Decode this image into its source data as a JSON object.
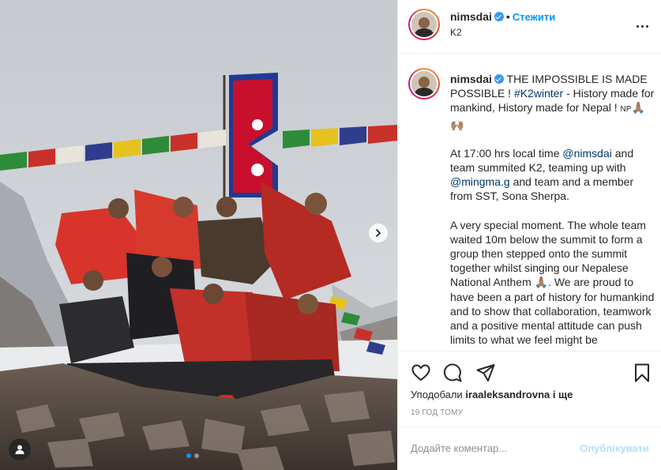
{
  "post": {
    "username": "nimsdai",
    "follow_label": "Стежити",
    "location": "K2"
  },
  "caption": {
    "username": "nimsdai",
    "p1_text": "THE IMPOSSIBLE IS MADE POSSIBLE ! ",
    "p1_hashtag": "#K2winter",
    "p1_rest": " - History made for mankind, History made for Nepal ! ",
    "p1_flag": "NP",
    "p1_emoji": "🙏🏽🙌🏽",
    "p2_a": "At 17:00 hrs local time ",
    "p2_mention1": "@nimsdai",
    "p2_b": " and team summited K2, teaming up with ",
    "p2_mention2": "@mingma.g",
    "p2_c": " and team and a member from SST, Sona Sherpa.",
    "p3_a": "A very special moment. The whole team waited 10m below the summit to form a group then stepped onto the summit together whilst singing our Nepalese National Anthem ",
    "p3_emoji": "🙏🏽",
    "p3_b": ". We are proud to have been a part of history for humankind and to show that collaboration, teamwork and a positive mental attitude can push limits to what we feel might be"
  },
  "likes": {
    "prefix": "Уподобали",
    "user": "iraaleksandrovna",
    "suffix": "і ще"
  },
  "time_ago": "19 ГОД ТОМУ",
  "comment": {
    "placeholder": "Додайте коментар...",
    "post_label": "Опублікувати"
  },
  "icons": {
    "like": "heart-icon",
    "comment": "comment-icon",
    "share": "paper-plane-icon",
    "save": "bookmark-icon",
    "more": "more-dots-icon",
    "next": "chevron-right-icon",
    "tag": "person-tag-icon"
  },
  "carousel": {
    "active_index": 0,
    "count": 2
  },
  "colors": {
    "accent": "#0095f6",
    "link": "#00376b",
    "muted": "#8e8e8e",
    "verified": "#3897f0"
  }
}
